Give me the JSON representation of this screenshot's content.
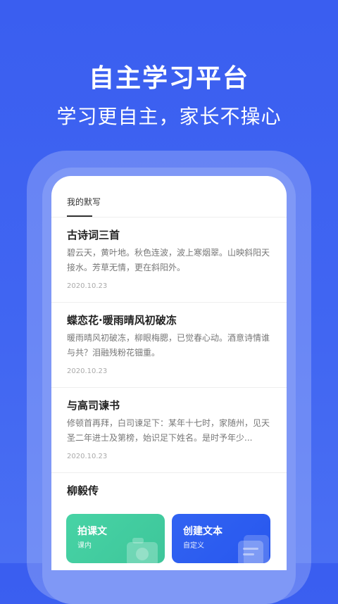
{
  "promo": {
    "headline": "自主学习平台",
    "subline": "学习更自主，家长不操心"
  },
  "screen": {
    "tab_title": "我的默写",
    "items": [
      {
        "title": "古诗词三首",
        "text": "碧云天，黄叶地。秋色连波，波上寒烟翠。山映斜阳天接水。芳草无情，更在斜阳外。",
        "date": "2020.10.23"
      },
      {
        "title": "蝶恋花·暖雨晴风初破冻",
        "text": "暖雨晴风初破冻，柳眼梅腮，已觉春心动。酒意诗情谁与共？泪融残粉花钿重。",
        "date": "2020.10.23"
      },
      {
        "title": "与高司谏书",
        "text": "修顿首再拜，白司谏足下：某年十七时，家随州，见天圣二年进士及第榜，始识足下姓名。是时予年少...",
        "date": "2020.10.23"
      },
      {
        "title": "柳毅传",
        "text": "",
        "date": ""
      }
    ],
    "buttons": [
      {
        "label": "拍课文",
        "sub": "课内",
        "icon": "camera-icon",
        "color": "#43cfa1"
      },
      {
        "label": "创建文本",
        "sub": "自定义",
        "icon": "document-icon",
        "color": "#2d5ef0"
      }
    ]
  },
  "colors": {
    "background": "#3f64f1",
    "accent_green": "#43cfa1",
    "accent_blue": "#2d5ef0"
  }
}
